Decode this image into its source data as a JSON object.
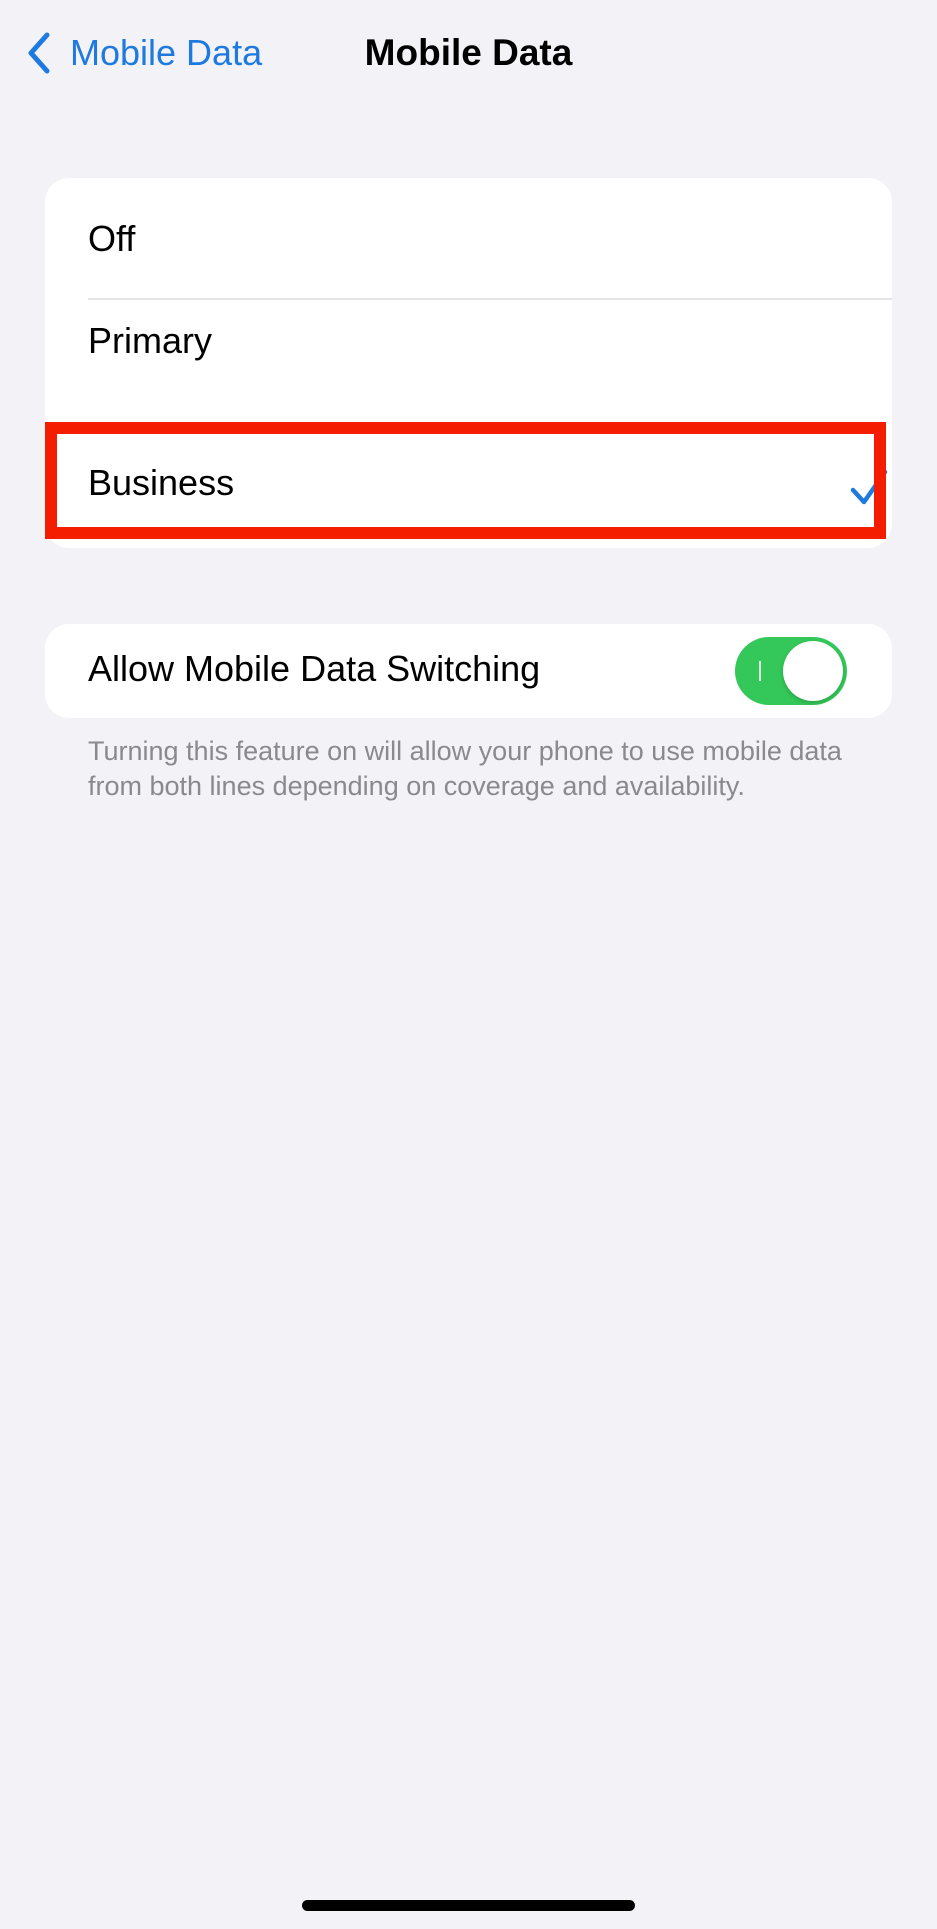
{
  "nav": {
    "back_label": "Mobile Data",
    "title": "Mobile Data"
  },
  "options": {
    "items": [
      {
        "label": "Off",
        "selected": false
      },
      {
        "label": "Primary",
        "selected": false
      },
      {
        "label": "Business",
        "selected": true
      }
    ],
    "check_icon": "checkmark-icon"
  },
  "switching": {
    "label": "Allow Mobile Data Switching",
    "enabled": true,
    "footer": "Turning this feature on will allow your phone to use mobile data from both lines depending on coverage and availability."
  },
  "colors": {
    "accent": "#1f7ae0",
    "toggle_on": "#34c759",
    "highlight": "#f51d00",
    "background": "#f2f2f7"
  }
}
